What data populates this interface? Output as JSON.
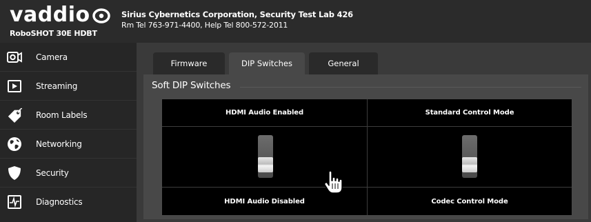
{
  "brand": {
    "logo": "vaddio",
    "model": "RoboSHOT 30E HDBT"
  },
  "device": {
    "name": "Sirius Cybernetics Corporation, Security Test Lab 426",
    "tel": "Rm Tel 763-971-4400, Help Tel 800-572-2011"
  },
  "sidebar": {
    "items": [
      {
        "label": "Camera",
        "icon": "camera-icon"
      },
      {
        "label": "Streaming",
        "icon": "play-icon"
      },
      {
        "label": "Room Labels",
        "icon": "tag-icon"
      },
      {
        "label": "Networking",
        "icon": "globe-icon"
      },
      {
        "label": "Security",
        "icon": "shield-icon"
      },
      {
        "label": "Diagnostics",
        "icon": "pulse-icon"
      }
    ]
  },
  "tabs": [
    {
      "label": "Firmware",
      "active": false
    },
    {
      "label": "DIP Switches",
      "active": true
    },
    {
      "label": "General",
      "active": false
    }
  ],
  "panel": {
    "title": "Soft DIP Switches"
  },
  "dip_switches": [
    {
      "on_label": "HDMI Audio Enabled",
      "off_label": "HDMI Audio Disabled",
      "state": "off"
    },
    {
      "on_label": "Standard Control Mode",
      "off_label": "Codec Control Mode",
      "state": "off"
    }
  ],
  "colors": {
    "header_bg": "#2b2b2b",
    "sidebar_bg": "#262626",
    "main_bg": "#3a3a3a",
    "panel_bg": "#484848",
    "grid_bg": "#000000",
    "text": "#ffffff"
  }
}
